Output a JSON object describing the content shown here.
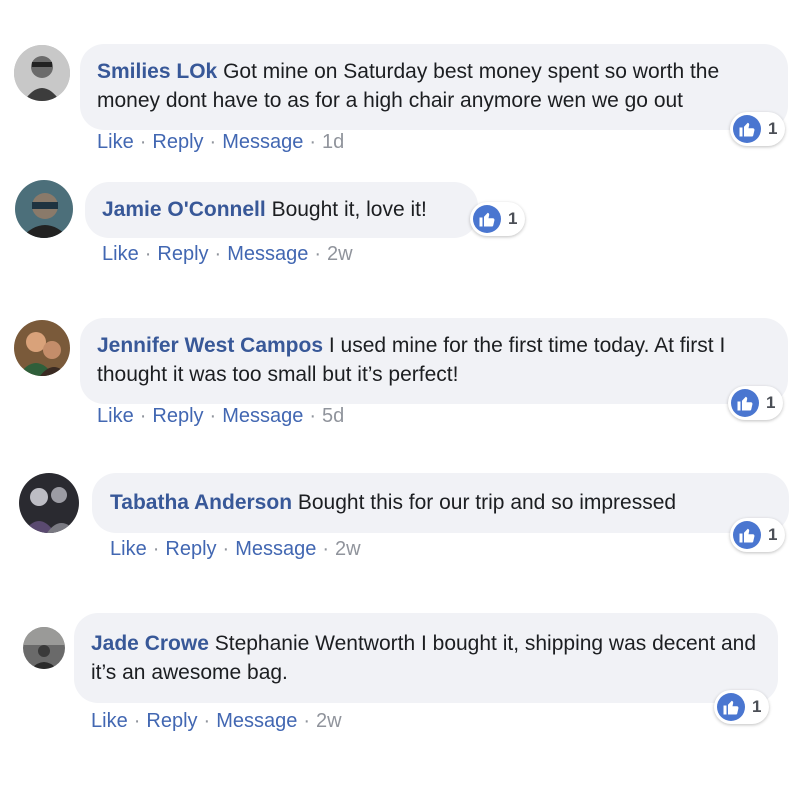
{
  "colors": {
    "name_link": "#385898",
    "action_link": "#4267b2",
    "bubble_bg": "#f1f2f6",
    "like_blue": "#4a76d0"
  },
  "comments": [
    {
      "author": "Smilies LOk",
      "text": "Got mine on Saturday best money spent so worth the money dont have to as for a high chair anymore wen we go out",
      "like_label": "Like",
      "reply_label": "Reply",
      "message_label": "Message",
      "time": "1d",
      "reaction_icon": "thumbs-up-icon",
      "reaction_count": "1"
    },
    {
      "author": "Jamie O'Connell",
      "text": "Bought it, love it!",
      "like_label": "Like",
      "reply_label": "Reply",
      "message_label": "Message",
      "time": "2w",
      "reaction_icon": "thumbs-up-icon",
      "reaction_count": "1"
    },
    {
      "author": "Jennifer West Campos",
      "text": "I used mine for the first time today. At first I thought it was too small but it’s perfect!",
      "like_label": "Like",
      "reply_label": "Reply",
      "message_label": "Message",
      "time": "5d",
      "reaction_icon": "thumbs-up-icon",
      "reaction_count": "1"
    },
    {
      "author": "Tabatha Anderson",
      "text": "Bought this for our trip and so impressed",
      "like_label": "Like",
      "reply_label": "Reply",
      "message_label": "Message",
      "time": "2w",
      "reaction_icon": "thumbs-up-icon",
      "reaction_count": "1"
    },
    {
      "author": "Jade Crowe",
      "text": "Stephanie Wentworth I bought it, shipping was decent and it’s an awesome bag.",
      "like_label": "Like",
      "reply_label": "Reply",
      "message_label": "Message",
      "time": "2w",
      "reaction_icon": "thumbs-up-icon",
      "reaction_count": "1"
    }
  ]
}
